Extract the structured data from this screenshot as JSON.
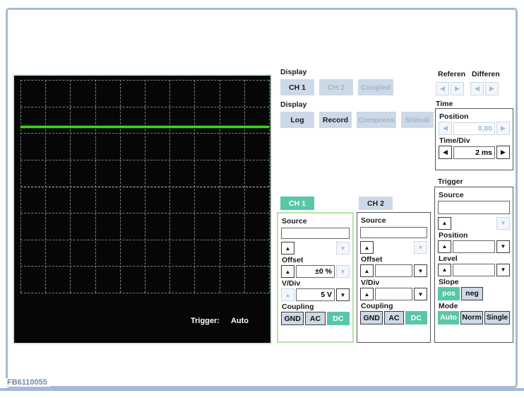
{
  "footer": {
    "id": "FB6110055"
  },
  "icons": {
    "up": "▲",
    "down": "▼",
    "left": "◀",
    "right": "▶"
  },
  "colors": {
    "accent_teal": "#58c7a8",
    "button_bg": "#ccd9e6",
    "disabled_text": "#9fb6cd",
    "trace_green": "#3fd61f",
    "frame_border": "#a6bad3",
    "scope_bg": "#060606"
  },
  "scope": {
    "trigger_label": "Trigger:",
    "trigger_mode": "Auto"
  },
  "display_channel": {
    "title": "Display",
    "buttons": [
      {
        "label": "CH 1"
      },
      {
        "label": "CH 2"
      },
      {
        "label": "Coupled"
      }
    ]
  },
  "display_mode": {
    "title": "Display",
    "buttons": [
      {
        "label": "Log"
      },
      {
        "label": "Record"
      },
      {
        "label": "Compress"
      },
      {
        "label": "Stimuli"
      }
    ]
  },
  "reference": {
    "label": "Referen"
  },
  "difference": {
    "label": "Differen"
  },
  "time": {
    "title": "Time",
    "position": {
      "label": "Position",
      "value": "0,00"
    },
    "time_div": {
      "label": "Time/Div",
      "value": "2 ms"
    }
  },
  "ch1": {
    "tab_label": "CH 1",
    "source_label": "Source",
    "source_value": "",
    "offset_label": "Offset",
    "offset_value": "±0 %",
    "vdiv_label": "V/Div",
    "vdiv_value": "5 V",
    "coupling_label": "Coupling",
    "gnd": "GND",
    "ac": "AC",
    "dc": "DC",
    "coupling_selected": "DC"
  },
  "ch2": {
    "tab_label": "CH 2",
    "source_label": "Source",
    "source_value": "",
    "offset_label": "Offset",
    "offset_value": "",
    "vdiv_label": "V/Div",
    "vdiv_value": "",
    "coupling_label": "Coupling",
    "gnd": "GND",
    "ac": "AC",
    "dc": "DC",
    "coupling_selected": "DC"
  },
  "trigger": {
    "title": "Trigger",
    "source_label": "Source",
    "source_value": "",
    "position_label": "Position",
    "position_value": "",
    "level_label": "Level",
    "level_value": "",
    "slope_label": "Slope",
    "slope_pos": "pos",
    "slope_neg": "neg",
    "slope_selected": "pos",
    "mode_label": "Mode",
    "mode_auto": "Auto",
    "mode_norm": "Norm",
    "mode_single": "Single",
    "mode_selected": "Auto"
  }
}
